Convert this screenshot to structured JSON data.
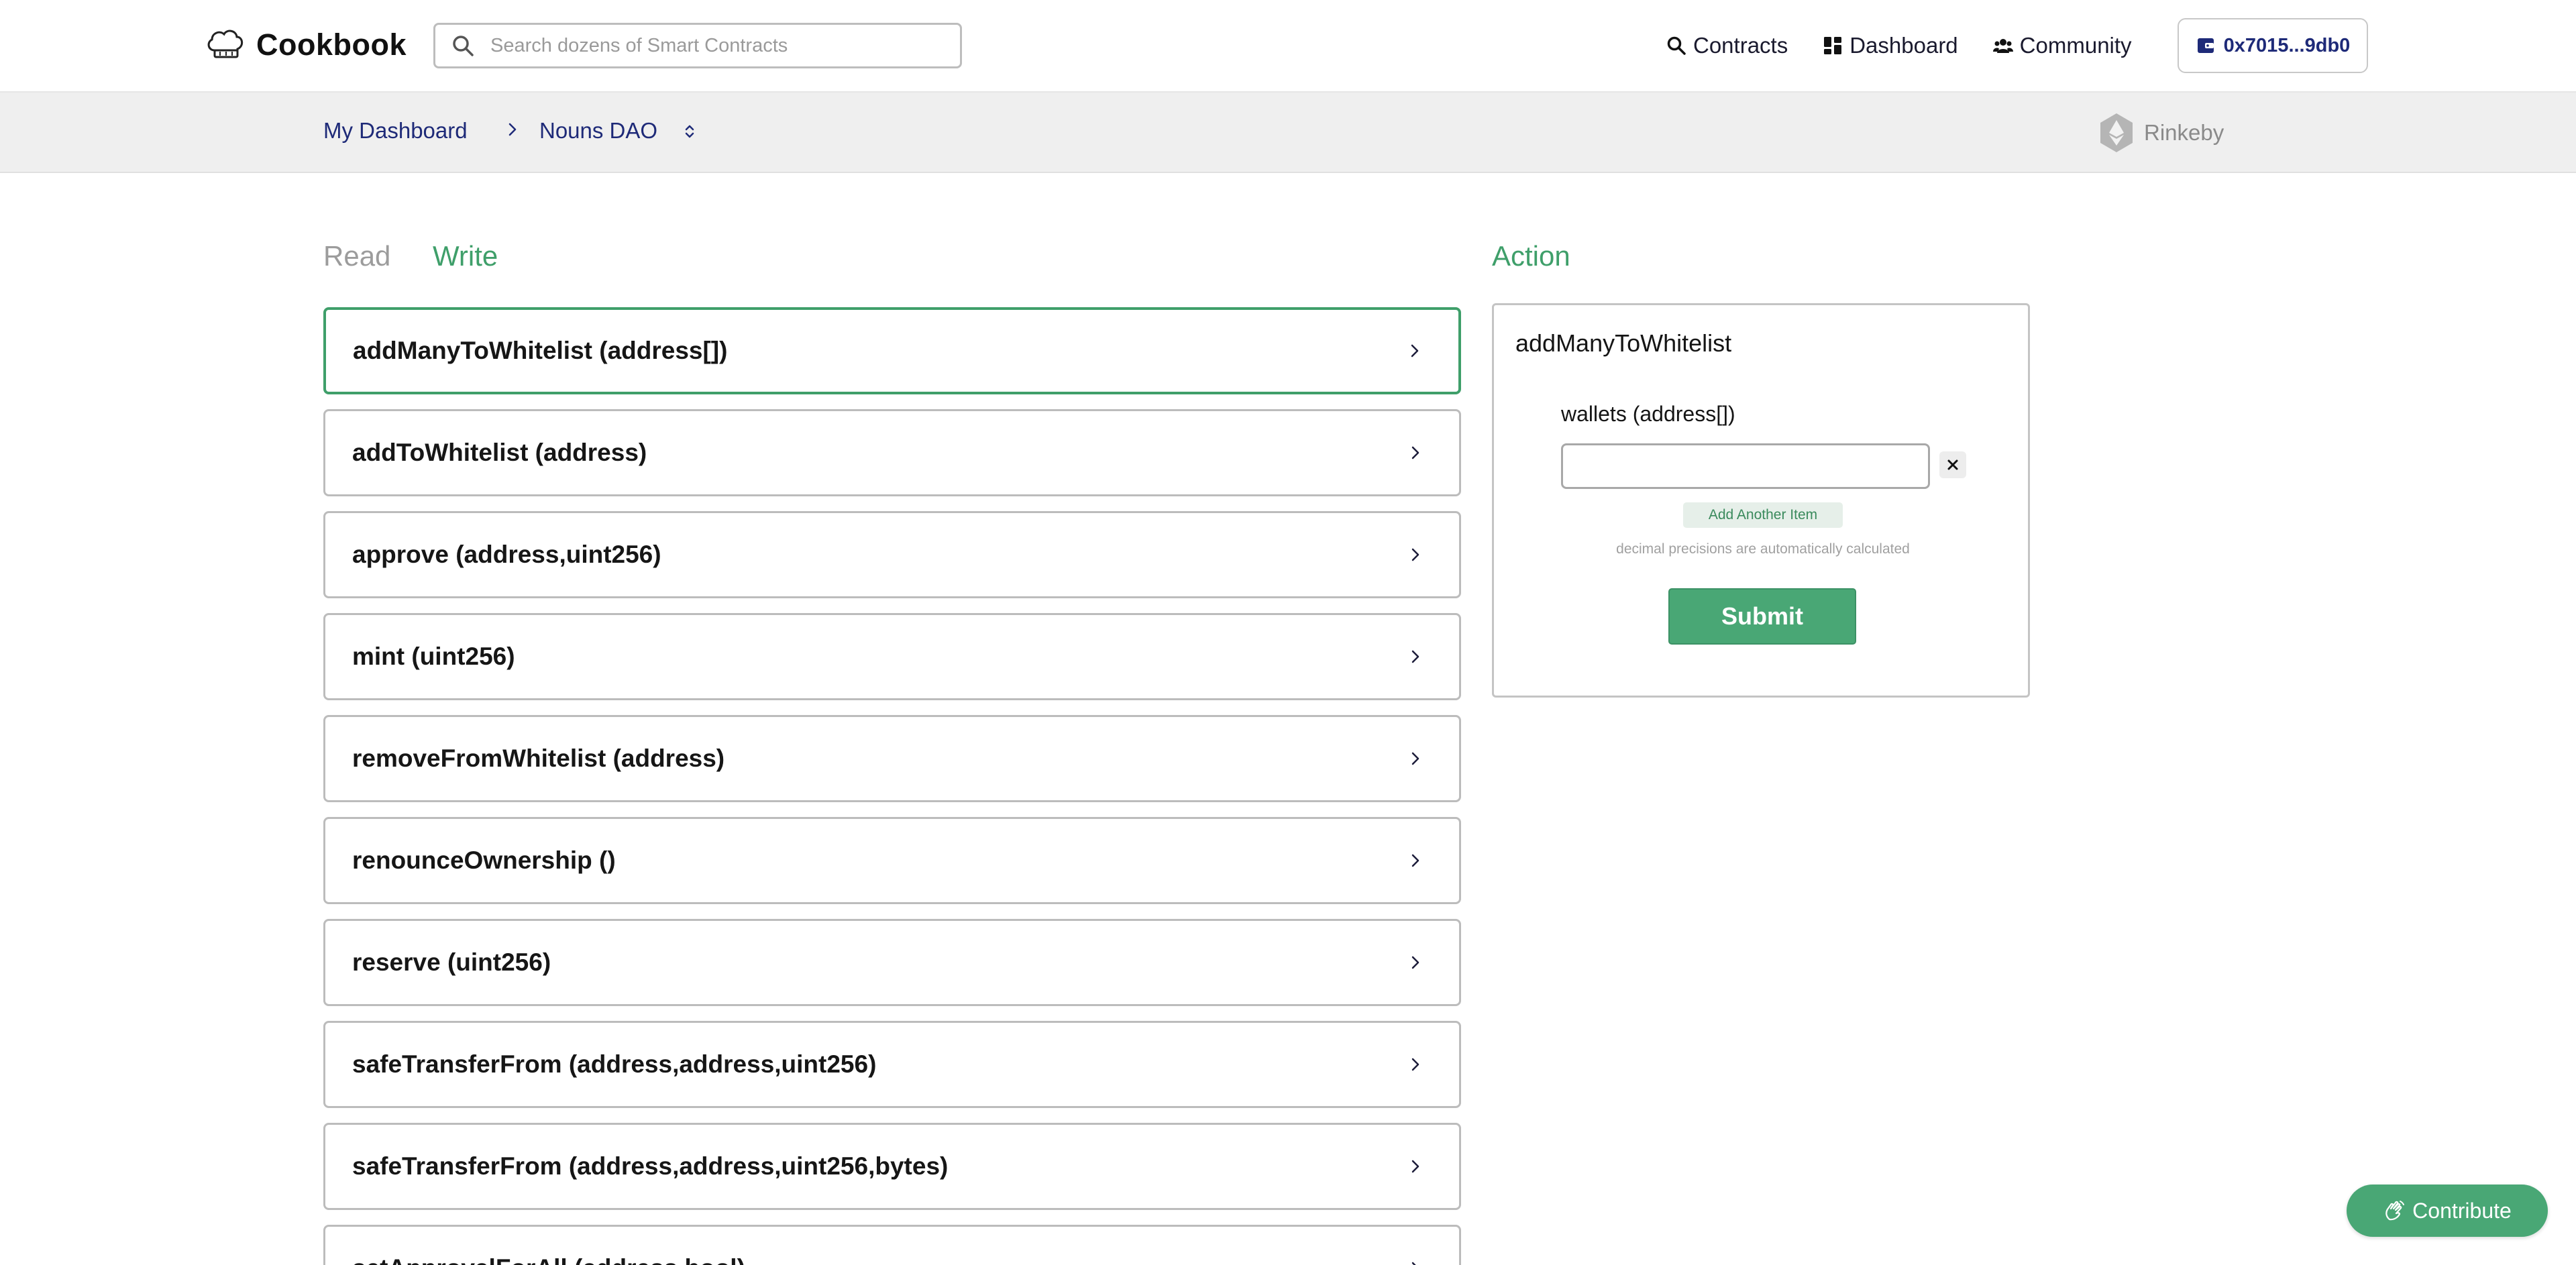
{
  "app": {
    "brand": "Cookbook",
    "accent_color": "#49a775"
  },
  "search": {
    "placeholder": "Search dozens of Smart Contracts",
    "value": ""
  },
  "nav": {
    "contracts": "Contracts",
    "dashboard": "Dashboard",
    "community": "Community",
    "wallet": "0x7015...9db0"
  },
  "breadcrumb": {
    "home": "My Dashboard",
    "current": "Nouns DAO",
    "network": "Rinkeby"
  },
  "tabs": {
    "read": "Read",
    "write": "Write",
    "active": "write"
  },
  "functions": [
    {
      "label": "addManyToWhitelist (address[])",
      "active": true
    },
    {
      "label": "addToWhitelist (address)",
      "active": false
    },
    {
      "label": "approve (address,uint256)",
      "active": false
    },
    {
      "label": "mint (uint256)",
      "active": false
    },
    {
      "label": "removeFromWhitelist (address)",
      "active": false
    },
    {
      "label": "renounceOwnership ()",
      "active": false
    },
    {
      "label": "reserve (uint256)",
      "active": false
    },
    {
      "label": "safeTransferFrom (address,address,uint256)",
      "active": false
    },
    {
      "label": "safeTransferFrom (address,address,uint256,bytes)",
      "active": false
    },
    {
      "label": "setApprovalForAll (address,bool)",
      "active": false
    }
  ],
  "action": {
    "heading": "Action",
    "function_name": "addManyToWhitelist",
    "param_label": "wallets (address[])",
    "param_value": "",
    "add_item_label": "Add Another Item",
    "hint": "decimal precisions are automatically calculated",
    "submit_label": "Submit"
  },
  "contribute": {
    "label": "Contribute"
  }
}
